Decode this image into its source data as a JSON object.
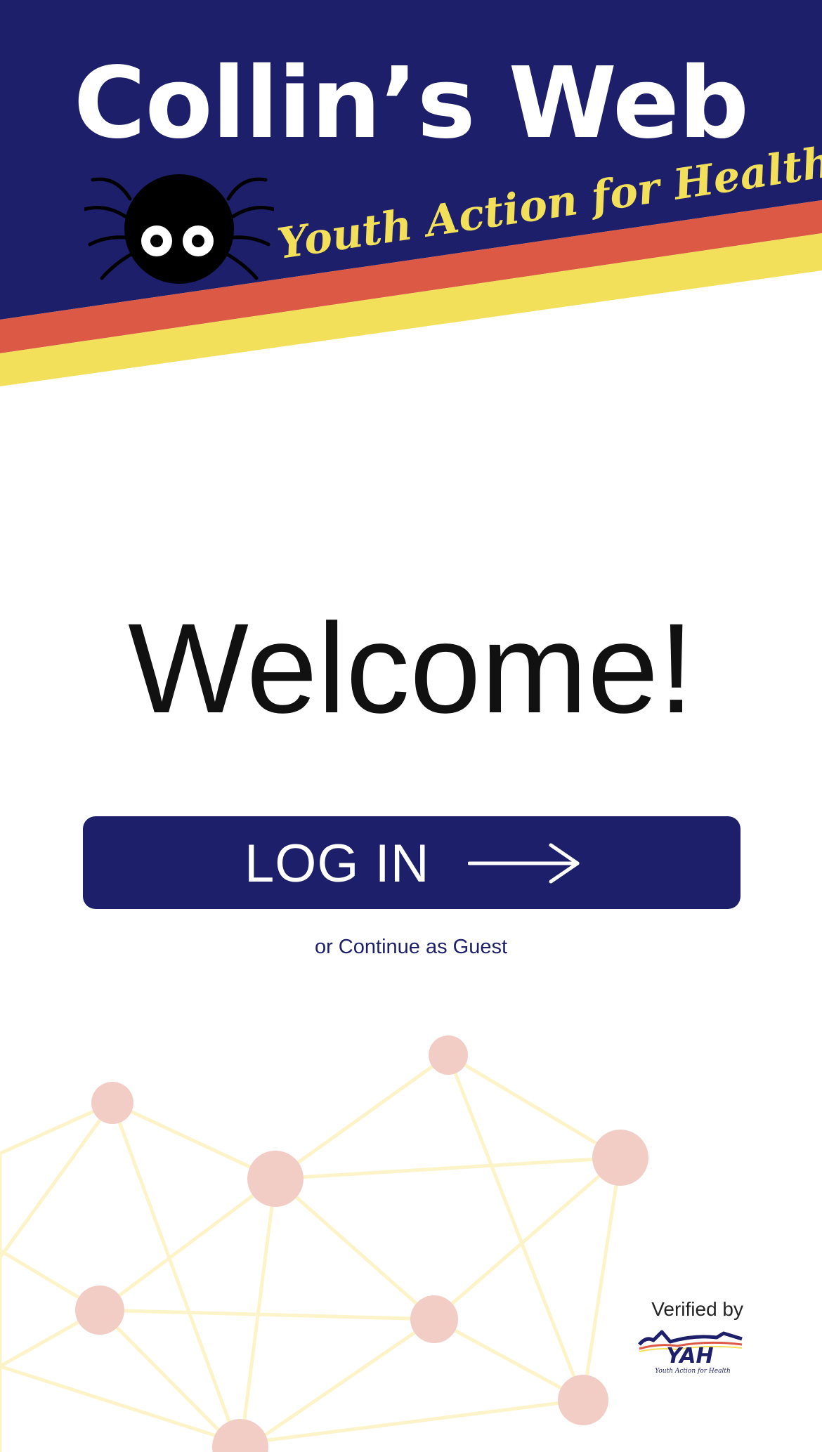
{
  "app": {
    "title": "Collin’s Web",
    "tagline": "Youth Action for Health"
  },
  "welcome": {
    "heading": "Welcome!"
  },
  "login": {
    "label": "LOG IN",
    "icon": "arrow-right-icon"
  },
  "guest": {
    "label": "or Continue as Guest"
  },
  "verified": {
    "label": "Verified by",
    "logo_text": "YAH",
    "logo_subtext": "Youth Action for Health"
  },
  "colors": {
    "navy": "#1d1f6a",
    "orange": "#dc5a45",
    "yellow": "#f3e05a",
    "node_pink": "#f1cdc6",
    "line_yellow": "#fcf4c8"
  }
}
